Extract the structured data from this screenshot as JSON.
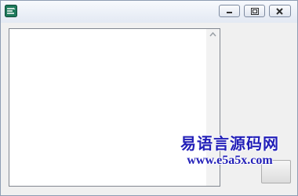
{
  "window": {
    "icon": "app-icon",
    "controls": [
      "minimize-icon",
      "maximize-icon",
      "close-icon"
    ]
  },
  "listbox": {
    "items": []
  },
  "watermark": {
    "title": "易语言源码网",
    "url": "www.e5a5x.com"
  },
  "colors": {
    "watermark": "#2320b8",
    "titlebar_top": "#f7f9fd",
    "titlebar_bottom": "#e3e9f3"
  }
}
